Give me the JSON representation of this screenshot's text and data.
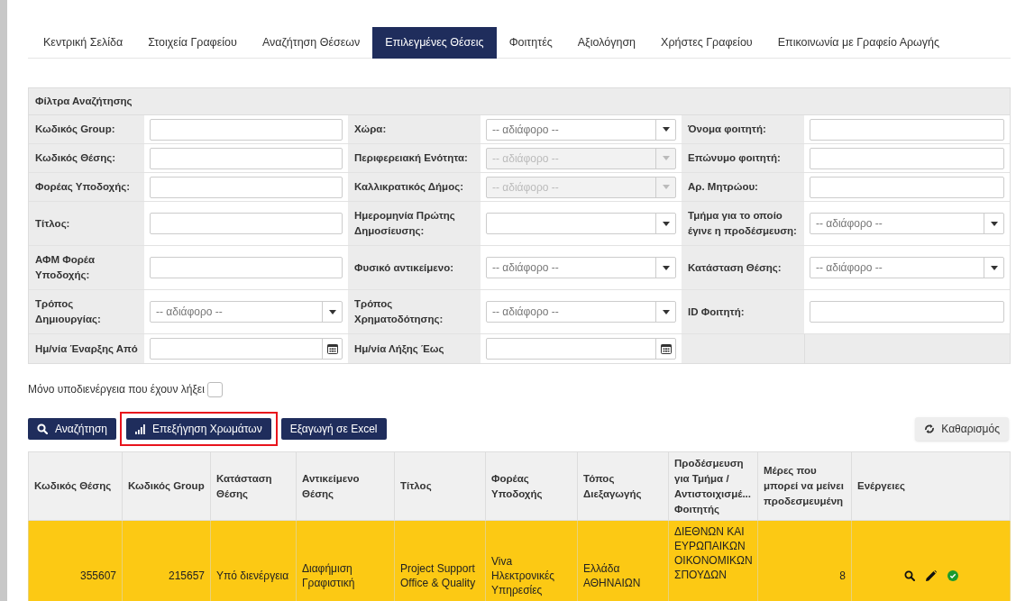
{
  "tabs": [
    {
      "label": "Κεντρική Σελίδα",
      "selected": false
    },
    {
      "label": "Στοιχεία Γραφείου",
      "selected": false
    },
    {
      "label": "Αναζήτηση Θέσεων",
      "selected": false
    },
    {
      "label": "Επιλεγμένες Θέσεις",
      "selected": true
    },
    {
      "label": "Φοιτητές",
      "selected": false
    },
    {
      "label": "Αξιολόγηση",
      "selected": false
    },
    {
      "label": "Χρήστες Γραφείου",
      "selected": false
    },
    {
      "label": "Επικοινωνία με Γραφείο Αρωγής",
      "selected": false
    }
  ],
  "filters": {
    "title": "Φίλτρα Αναζήτησης",
    "rows": [
      [
        {
          "label": "Κωδικός Group:",
          "kind": "text"
        },
        {
          "label": "Χώρα:",
          "kind": "select",
          "value": "-- αδιάφορο --",
          "disabled": false
        },
        {
          "label": "Όνομα φοιτητή:",
          "kind": "text"
        }
      ],
      [
        {
          "label": "Κωδικός Θέσης:",
          "kind": "text"
        },
        {
          "label": "Περιφερειακή Ενότητα:",
          "kind": "select",
          "value": "-- αδιάφορο --",
          "disabled": true
        },
        {
          "label": "Επώνυμο φοιτητή:",
          "kind": "text"
        }
      ],
      [
        {
          "label": "Φορέας Υποδοχής:",
          "kind": "text"
        },
        {
          "label": "Καλλικρατικός Δήμος:",
          "kind": "select",
          "value": "-- αδιάφορο --",
          "disabled": true
        },
        {
          "label": "Αρ. Μητρώου:",
          "kind": "text"
        }
      ],
      [
        {
          "label": "Τίτλος:",
          "kind": "text"
        },
        {
          "label": "Ημερομηνία Πρώτης Δημοσίευσης:",
          "kind": "select",
          "disabled": false
        },
        {
          "label": "Τμήμα για το οποίο έγινε η προδέσμευση:",
          "kind": "select",
          "value": "-- αδιάφορο --",
          "disabled": false
        }
      ],
      [
        {
          "label": "ΑΦΜ Φορέα Υποδοχής:",
          "kind": "text"
        },
        {
          "label": "Φυσικό αντικείμενο:",
          "kind": "select",
          "value": "-- αδιάφορο --",
          "disabled": false
        },
        {
          "label": "Κατάσταση Θέσης:",
          "kind": "select",
          "value": "-- αδιάφορο --",
          "disabled": false
        }
      ],
      [
        {
          "label": "Τρόπος Δημιουργίας:",
          "kind": "select",
          "value": "-- αδιάφορο --",
          "disabled": false
        },
        {
          "label": "Τρόπος Χρηματοδότησης:",
          "kind": "select",
          "value": "-- αδιάφορο --",
          "disabled": false
        },
        {
          "label": "ID Φοιτητή:",
          "kind": "text"
        }
      ],
      [
        {
          "label": "Ημ/νία Έναρξης Από",
          "kind": "date"
        },
        {
          "label": "Ημ/νία Λήξης Έως",
          "kind": "date"
        },
        {
          "kind": "empty"
        }
      ]
    ]
  },
  "expired_only": {
    "label": "Μόνο υποδιενέργεια που έχουν λήξει",
    "checked": false
  },
  "buttons": [
    {
      "label": "Αναζήτηση",
      "kind": "search",
      "highlighted": false
    },
    {
      "label": "Επεξήγηση Χρωμάτων",
      "kind": "legend",
      "highlighted": true
    },
    {
      "label": "Εξαγωγή σε Excel",
      "kind": "export",
      "highlighted": false
    }
  ],
  "reset_button": {
    "label": "Καθαρισμός"
  },
  "table": {
    "columns": [
      {
        "label": "Κωδικός Θέσης",
        "kind": "number"
      },
      {
        "label": "Κωδικός Group",
        "kind": "number"
      },
      {
        "label": "Κατάσταση Θέσης",
        "kind": "text"
      },
      {
        "label": "Αντικείμενο Θέσης",
        "kind": "text"
      },
      {
        "label": "Τίτλος",
        "kind": "text"
      },
      {
        "label": "Φορέας Υποδοχής",
        "kind": "text"
      },
      {
        "label": "Τόπος Διεξαγωγής",
        "kind": "text"
      },
      {
        "label": "Προδέσμευση για Τμήμα / Αντιστοιχισμέ... Φοιτητής",
        "kind": "text"
      },
      {
        "label": "Μέρες που μπορεί να μείνει προδεσμευμένη",
        "kind": "number"
      },
      {
        "label": "Ενέργειες",
        "kind": "actions"
      }
    ],
    "rows": [
      {
        "color": "#fcc914",
        "cells": [
          "355607",
          "215657",
          "Υπό διενέργεια",
          "Διαφήμιση Γραφιστική",
          "Project Support Office & Quality",
          "Viva Ηλεκτρονικές Υπηρεσίες",
          "Ελλάδα ΑΘΗΝΑΙΩΝ",
          "ΔΙΕΘΝΩΝ ΚΑΙ ΕΥΡΩΠΑΙΚΩΝ ΟΙΚΟΝΟΜΙΚΩΝ ΣΠΟΥΔΩΝ",
          "8",
          ""
        ]
      }
    ]
  }
}
